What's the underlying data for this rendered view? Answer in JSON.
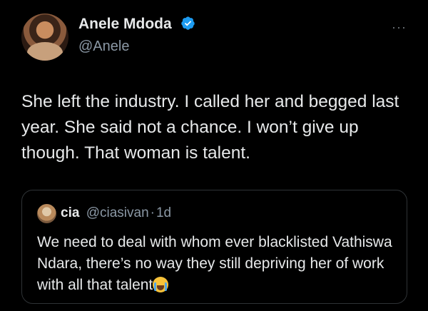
{
  "author": {
    "display_name": "Anele Mdoda",
    "handle": "@Anele",
    "verified": true,
    "avatar_icon": "profile-photo"
  },
  "more_label": "···",
  "tweet": {
    "text": "She left the industry. I called her and begged last year. She said not a chance. I won’t give up though. That woman is talent."
  },
  "quoted": {
    "display_name": "cia",
    "handle": "@ciasivan",
    "separator": "·",
    "time": "1d",
    "text": "We need to deal with whom ever blacklisted Vathiswa Ndara, there’s no way they still depriving her of work with all that talent",
    "emoji_icon": "loudly-crying-face-icon"
  },
  "colors": {
    "background": "#000000",
    "text": "#e7e9ea",
    "muted": "#8b98a5",
    "verified": "#1d9bf0",
    "border": "#2f3336"
  }
}
